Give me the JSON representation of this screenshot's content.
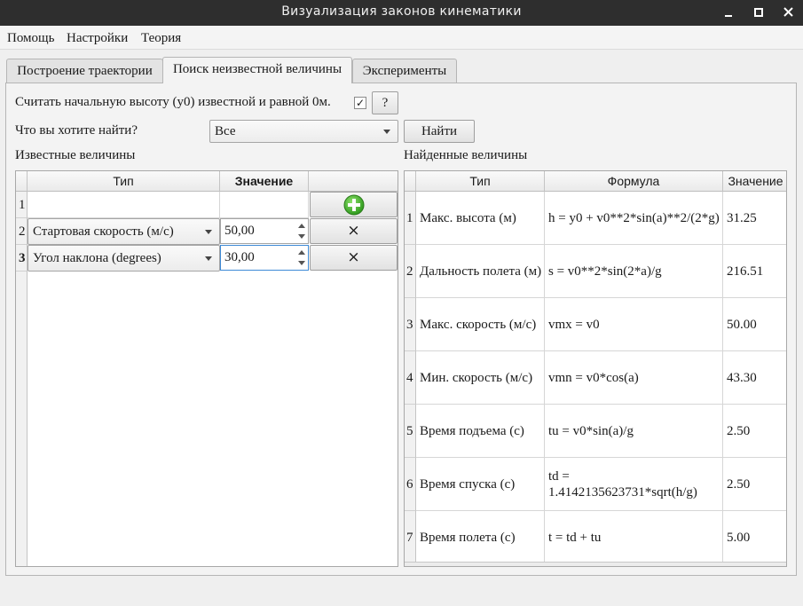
{
  "window": {
    "title": "Визуализация законов кинематики"
  },
  "menu": [
    "Помощь",
    "Настройки",
    "Теория"
  ],
  "tabs": [
    "Построение траектории",
    "Поиск неизвестной величины",
    "Эксперименты"
  ],
  "form": {
    "checkbox_label": "Считать начальную высоту (y0) известной и равной 0м.",
    "checkbox_checked": "✓",
    "help_button": "?",
    "find_label": "Что вы хотите найти?",
    "find_select": "Все",
    "find_button": "Найти"
  },
  "known": {
    "title": "Известные величины",
    "headers": [
      "Тип",
      "Значение",
      ""
    ],
    "rows": [
      {
        "num": "1",
        "type": "",
        "value": ""
      },
      {
        "num": "2",
        "type": "Стартовая скорость (м/с)",
        "value": "50,00",
        "remove": "×"
      },
      {
        "num": "3",
        "type": "Угол наклона (degrees)",
        "value": "30,00",
        "remove": "×"
      }
    ]
  },
  "found": {
    "title": "Найденные величины",
    "headers": [
      "Тип",
      "Формула",
      "Значение"
    ],
    "rows": [
      {
        "num": "1",
        "type": "Макс. высота (м)",
        "formula": "h = y0 + v0**2*sin(a)**2/(2*g)",
        "value": "31.25"
      },
      {
        "num": "2",
        "type": "Дальность полета (м)",
        "formula": "s = v0**2*sin(2*a)/g",
        "value": "216.51"
      },
      {
        "num": "3",
        "type": "Макс. скорость (м/с)",
        "formula": "vmx = v0",
        "value": "50.00"
      },
      {
        "num": "4",
        "type": "Мин. скорость (м/с)",
        "formula": "vmn = v0*cos(a)",
        "value": "43.30"
      },
      {
        "num": "5",
        "type": "Время подъема (с)",
        "formula": "tu = v0*sin(a)/g",
        "value": "2.50"
      },
      {
        "num": "6",
        "type": "Время спуска (с)",
        "formula": "td = 1.4142135623731*sqrt(h/g)",
        "value": "2.50"
      },
      {
        "num": "7",
        "type": "Время полета (с)",
        "formula": "t = td + tu",
        "value": "5.00"
      }
    ]
  }
}
